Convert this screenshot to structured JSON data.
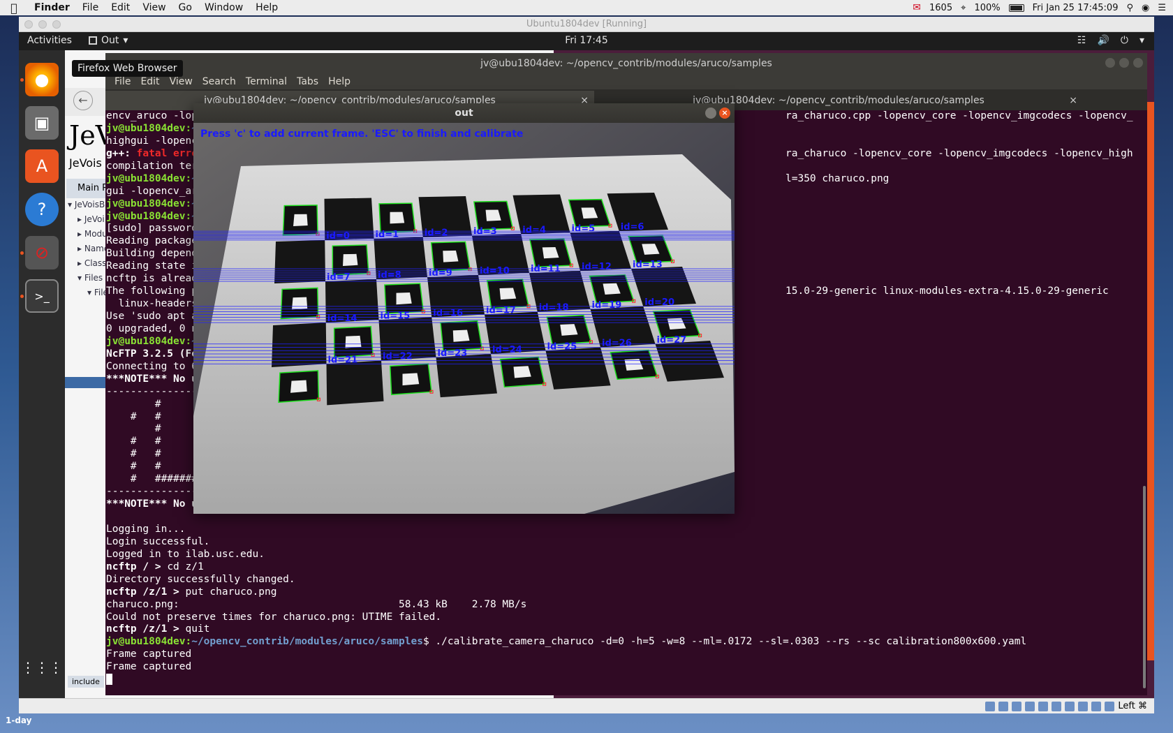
{
  "mac_menubar": {
    "app": "Finder",
    "menus": [
      "File",
      "Edit",
      "View",
      "Go",
      "Window",
      "Help"
    ],
    "mail_count": "1605",
    "battery": "100%",
    "datetime": "Fri Jan 25  17:45:09"
  },
  "vbox": {
    "title": "Ubuntu1804dev [Running]",
    "status_host_key": "Left ⌘"
  },
  "ubuntu": {
    "activities": "Activities",
    "app_name": "Out",
    "clock": "Fri 17:45"
  },
  "firefox": {
    "tooltip": "Firefox Web Browser",
    "logo": "JeV",
    "subtitle": "JeVois S",
    "main_tab": "Main Pa",
    "tree": [
      "JeVoisBa",
      "JeVoi",
      "Modul",
      "Name",
      "Class",
      "Files",
      "File",
      "",
      "",
      "",
      "",
      "",
      "",
      "",
      "",
      "",
      "",
      "",
      "",
      "",
      "",
      "",
      "",
      "",
      "",
      "",
      "",
      "",
      "",
      "",
      "",
      "",
      "",
      "",
      "File"
    ],
    "include": "include"
  },
  "terminal": {
    "title": "jv@ubu1804dev: ~/opencv_contrib/modules/aruco/samples",
    "menu": [
      "File",
      "Edit",
      "View",
      "Search",
      "Terminal",
      "Tabs",
      "Help"
    ],
    "tabs": [
      "jv@ubu1804dev: ~/opencv_contrib/modules/aruco/samples",
      "jv@ubu1804dev: ~/opencv_contrib/modules/aruco/samples"
    ],
    "prompt_user": "jv@ubu1804dev:",
    "prompt_path": "~/opencv_contrib/modules/aruco/samples",
    "left_lines": [
      "encv_aruco -lop",
      "~",
      "highgui -lopenc",
      "g++: ",
      "compilation ter",
      "~",
      "gui -lopencv_ar",
      "~",
      "~",
      "[sudo] password",
      "Reading package",
      "Building depend",
      "Reading state i",
      "ncftp is alread",
      "The following p",
      "  linux-headers",
      "Use 'sudo apt a",
      "0 upgraded, 0 n",
      "~",
      "NcFTP 3.2.5 (Fe",
      "Connecting to 6",
      "***NOTE*** No u",
      "---------------",
      "        #",
      "    #   #",
      "        #",
      "    #   #",
      "    #   #",
      "    #   #",
      "    #   #######",
      "---------------",
      "***NOTE*** No u"
    ],
    "fatal_word": "fatal erro",
    "right_lines": [
      "ra_charuco.cpp -lopencv_core -lopencv_imgcodecs -lopencv_",
      "",
      "",
      "ra_charuco -lopencv_core -lopencv_imgcodecs -lopencv_high",
      "",
      "l=350 charuco.png",
      "",
      "",
      "",
      "",
      "",
      "",
      "",
      "",
      "15.0-29-generic linux-modules-extra-4.15.0-29-generic"
    ],
    "bottom_lines": {
      "blank": "",
      "logging": "Logging in...",
      "login_ok": "Login successful.",
      "logged_in": "Logged in to ilab.usc.edu.",
      "ncftp_cd_prompt": "ncftp / > ",
      "ncftp_cd_cmd": "cd z/1",
      "dir_changed": "Directory successfully changed.",
      "ncftp_put_prompt": "ncftp /z/1 > ",
      "ncftp_put_cmd": "put charuco.png",
      "transfer": "charuco.png:                                    58.43 kB    2.78 MB/s",
      "utime": "Could not preserve times for charuco.png: UTIME failed.",
      "ncftp_quit_prompt": "ncftp /z/1 > ",
      "ncftp_quit_cmd": "quit",
      "calib_cmd": "$ ./calibrate_camera_charuco -d=0 -h=5 -w=8 --ml=.0172 --sl=.0303 --rs --sc calibration800x600.yaml",
      "frame1": "Frame captured",
      "frame2": "Frame captured"
    }
  },
  "out_window": {
    "title": "out",
    "instruction": "Press 'c' to add current frame. 'ESC' to finish and calibrate",
    "marker_ids": [
      "id=6",
      "id=5",
      "id=4",
      "id=3",
      "id=2",
      "id=1",
      "id=0",
      "id=13",
      "id=12",
      "id=11",
      "id=10",
      "id=9",
      "id=8",
      "id=7",
      "id=20",
      "id=19",
      "id=18",
      "id=17",
      "id=16",
      "id=15",
      "id=14",
      "id=27",
      "id=26",
      "id=25",
      "id=24",
      "id=23",
      "id=22",
      "id=21"
    ]
  },
  "bottom": {
    "label": "1-day"
  },
  "colors": {
    "ubuntu_orange": "#e95420",
    "terminal_bg": "#300a24",
    "prompt_green": "#8ae234",
    "prompt_blue": "#729fcf",
    "marker_green": "#1ee01e",
    "marker_label_blue": "#1a1aff"
  }
}
